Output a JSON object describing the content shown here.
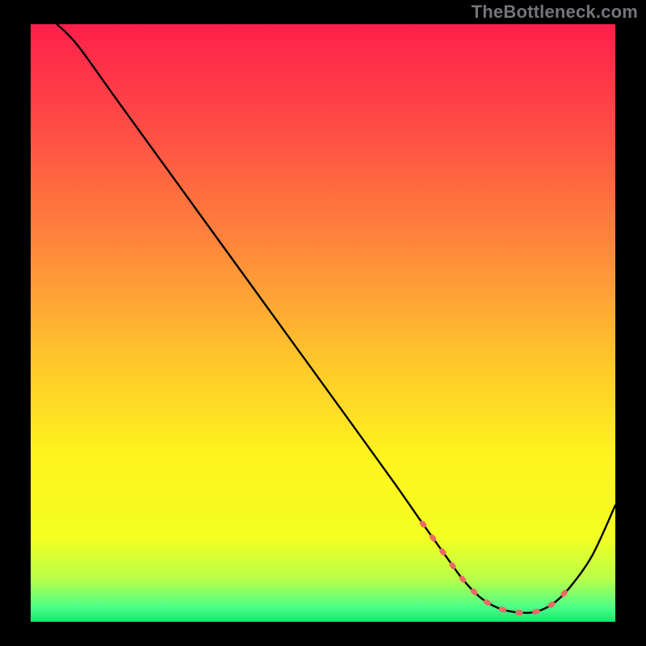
{
  "watermark": "TheBottleneck.com",
  "gradient": {
    "stops": [
      {
        "offset": 0.0,
        "color": "#ff1f4b"
      },
      {
        "offset": 0.18,
        "color": "#ff4e45"
      },
      {
        "offset": 0.38,
        "color": "#ff8a3a"
      },
      {
        "offset": 0.55,
        "color": "#ffc22d"
      },
      {
        "offset": 0.72,
        "color": "#fff31e"
      },
      {
        "offset": 0.86,
        "color": "#f3ff20"
      },
      {
        "offset": 0.93,
        "color": "#b7ff4a"
      },
      {
        "offset": 0.975,
        "color": "#4dff88"
      },
      {
        "offset": 1.0,
        "color": "#13e86b"
      }
    ]
  },
  "chart_data": {
    "type": "line",
    "title": "",
    "xlabel": "",
    "ylabel": "",
    "xlim": [
      0,
      100
    ],
    "ylim": [
      0,
      100
    ],
    "series": [
      {
        "name": "curve",
        "x": [
          4.5,
          8.0,
          15.0,
          25.0,
          35.0,
          45.0,
          55.0,
          62.0,
          67.0,
          71.0,
          74.0,
          77.0,
          80.0,
          83.0,
          86.0,
          89.0,
          92.0,
          96.0,
          100.0
        ],
        "y": [
          100.0,
          96.5,
          87.0,
          73.5,
          60.0,
          46.5,
          33.0,
          23.5,
          16.5,
          11.0,
          7.0,
          4.0,
          2.3,
          1.6,
          1.6,
          2.8,
          5.5,
          11.0,
          19.5
        ]
      }
    ],
    "dash_region": {
      "comment": "red dashed highlight near minimum",
      "x": [
        67.0,
        71.0,
        74.0,
        77.0,
        80.0,
        83.0,
        86.0,
        89.0,
        92.0
      ],
      "y": [
        16.5,
        11.0,
        7.0,
        4.0,
        2.3,
        1.6,
        1.6,
        2.8,
        5.5
      ]
    },
    "colors": {
      "curve": "#000000",
      "dash": "#e96a64"
    }
  }
}
